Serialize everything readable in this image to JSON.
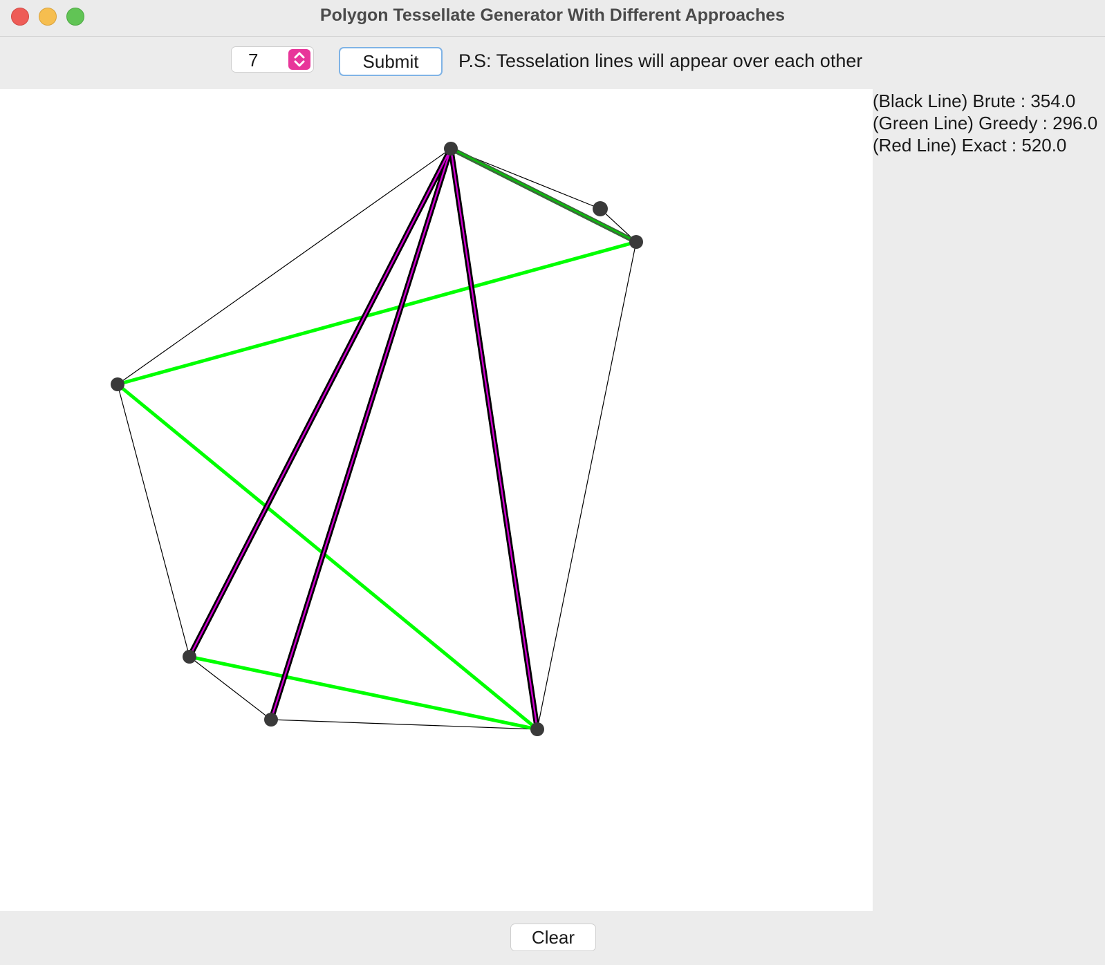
{
  "window": {
    "title": "Polygon Tessellate Generator With Different Approaches"
  },
  "toolbar": {
    "vertex_count": "7",
    "submit_label": "Submit",
    "note": "P.S: Tesselation lines will appear over each other"
  },
  "results": {
    "brute": "(Black Line) Brute : 354.0",
    "greedy": "(Green Line) Greedy : 296.0",
    "exact": "(Red Line) Exact : 520.0"
  },
  "footer": {
    "clear_label": "Clear"
  },
  "colors": {
    "polygon_edge": "#000000",
    "brute_line": "#000000",
    "greedy_line": "#00ff00",
    "exact_line": "#cc00cc",
    "vertex": "#3a3a3a",
    "spinner_accent": "#e8369a"
  }
}
